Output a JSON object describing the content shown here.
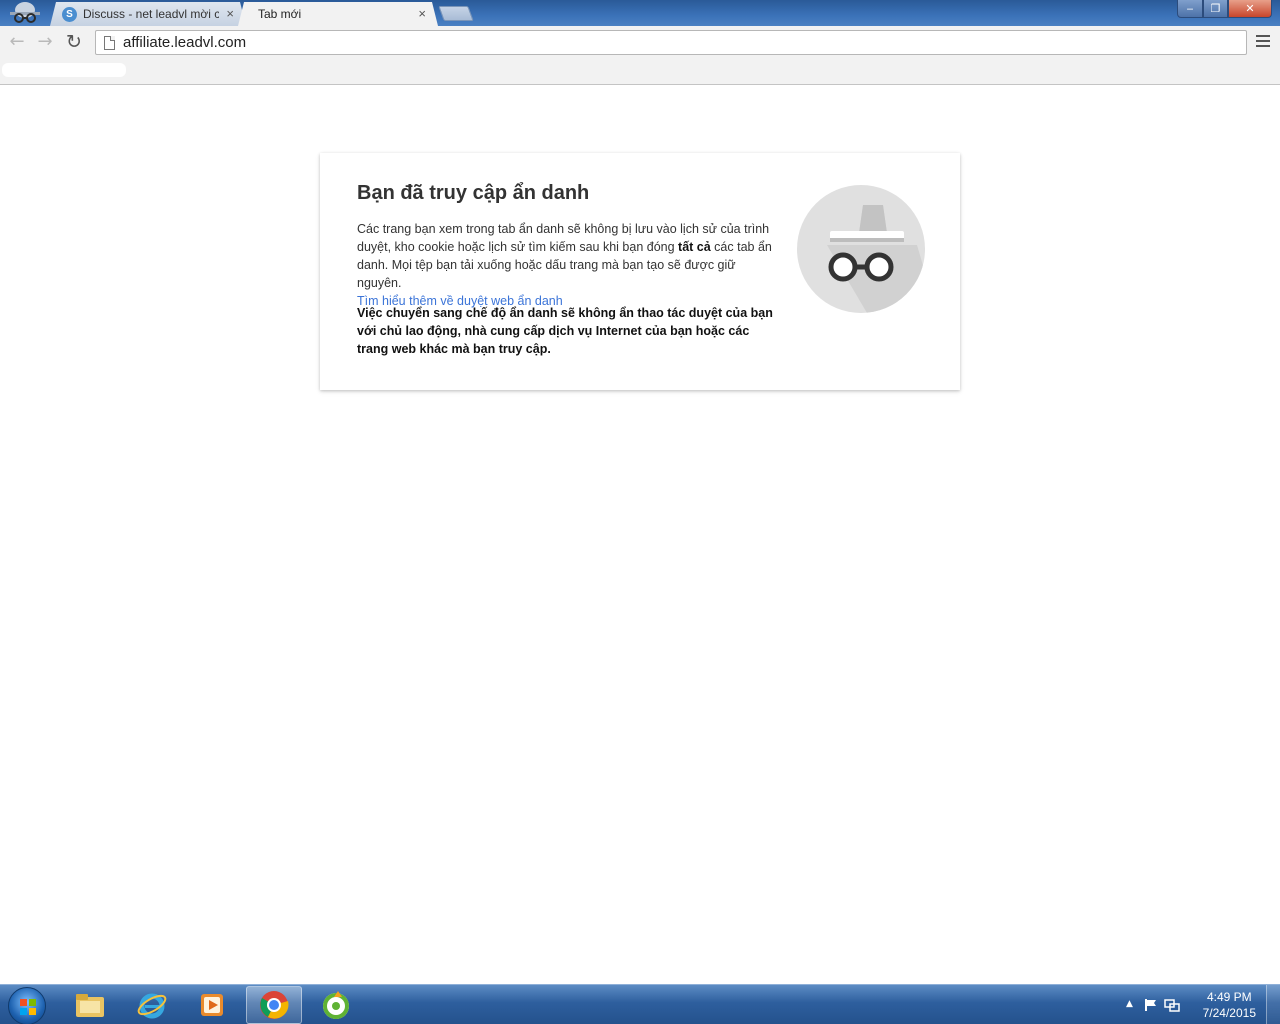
{
  "browser": {
    "tabs": [
      {
        "label": "Discuss - net leadvl mời cá",
        "active": false
      },
      {
        "label": "Tab mới",
        "active": true
      }
    ],
    "tab_close_glyph": "×",
    "address": "affiliate.leadvl.com",
    "window_controls": {
      "minimize": "‒",
      "maximize": "❐",
      "close": "✕"
    }
  },
  "incognito": {
    "title": "Bạn đã truy cập ẩn danh",
    "body_part1": "Các trang bạn xem trong tab ẩn danh sẽ không bị lưu vào lịch sử của trình duyệt, kho cookie hoặc lịch sử tìm kiếm sau khi bạn đóng ",
    "body_bold": "tất cả",
    "body_part2": " các tab ẩn danh. Mọi tệp bạn tải xuống hoặc dấu trang mà bạn tạo sẽ được giữ nguyên.",
    "learn_more": "Tìm hiểu thêm về duyệt web ẩn danh",
    "warning": "Việc chuyển sang chế độ ẩn danh sẽ không ẩn thao tác duyệt của bạn với chủ lao động, nhà cung cấp dịch vụ Internet của bạn hoặc các trang web khác mà bạn truy cập."
  },
  "taskbar": {
    "pinned": [
      "file-explorer-icon",
      "internet-explorer-icon",
      "media-player-icon",
      "chrome-icon",
      "coccoc-icon"
    ],
    "clock_time": "4:49 PM",
    "clock_date": "7/24/2015"
  },
  "colors": {
    "title_bar": "#3b72b8",
    "toolbar": "#f2f2f2",
    "link": "#3b74d8",
    "taskbar": "#2e5f9e"
  }
}
